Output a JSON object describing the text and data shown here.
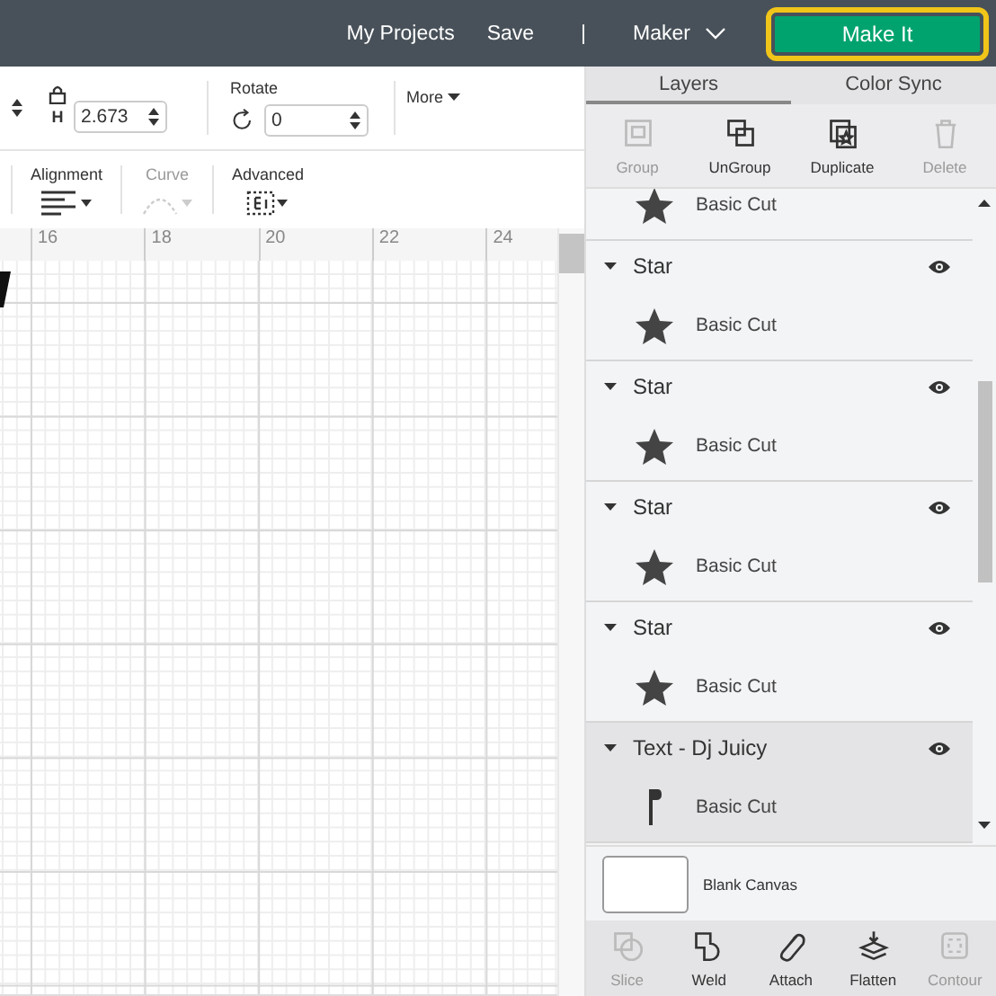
{
  "top_bar": {
    "links": [
      "My Projects",
      "Save"
    ],
    "separator": "|",
    "machine": "Maker",
    "primary_button": "Make It"
  },
  "toolbar": {
    "height_label": "H",
    "height_value": "2.673",
    "rotate_label": "Rotate",
    "rotate_value": "0",
    "more": "More",
    "tools": [
      {
        "label": "Alignment",
        "disabled": false,
        "kind": "align"
      },
      {
        "label": "Curve",
        "disabled": true,
        "kind": "curve"
      },
      {
        "label": "Advanced",
        "disabled": false,
        "kind": "advanced"
      }
    ]
  },
  "ruler": [
    "16",
    "18",
    "20",
    "22",
    "24"
  ],
  "panel": {
    "tabs": [
      {
        "label": "Layers",
        "selected": true
      },
      {
        "label": "Color Sync",
        "selected": false
      }
    ],
    "actions": [
      {
        "label": "Group",
        "disabled": true,
        "kind": "group"
      },
      {
        "label": "UnGroup",
        "disabled": false,
        "kind": "ungroup"
      },
      {
        "label": "Duplicate",
        "disabled": false,
        "kind": "duplicate"
      },
      {
        "label": "Delete",
        "disabled": true,
        "kind": "delete"
      }
    ],
    "layers": [
      {
        "children": [
          {
            "label": "Basic Cut",
            "kind": "star"
          }
        ]
      },
      {
        "name": "Star",
        "expanded": true,
        "selected": false,
        "children": [
          {
            "label": "Basic Cut",
            "kind": "star"
          }
        ]
      },
      {
        "name": "Star",
        "expanded": true,
        "selected": false,
        "children": [
          {
            "label": "Basic Cut",
            "kind": "star"
          }
        ]
      },
      {
        "name": "Star",
        "expanded": true,
        "selected": false,
        "children": [
          {
            "label": "Basic Cut",
            "kind": "star"
          }
        ]
      },
      {
        "name": "Star",
        "expanded": true,
        "selected": false,
        "children": [
          {
            "label": "Basic Cut",
            "kind": "star"
          }
        ]
      },
      {
        "name": "Text - Dj Juicy",
        "expanded": true,
        "selected": true,
        "children": [
          {
            "label": "Basic Cut",
            "kind": "letter"
          }
        ]
      }
    ],
    "canvas_label": "Blank Canvas",
    "bottom_actions": [
      {
        "label": "Slice",
        "disabled": true,
        "kind": "slice"
      },
      {
        "label": "Weld",
        "disabled": false,
        "kind": "weld"
      },
      {
        "label": "Attach",
        "disabled": false,
        "kind": "attach"
      },
      {
        "label": "Flatten",
        "disabled": false,
        "kind": "flatten"
      },
      {
        "label": "Contour",
        "disabled": true,
        "kind": "contour"
      }
    ]
  }
}
